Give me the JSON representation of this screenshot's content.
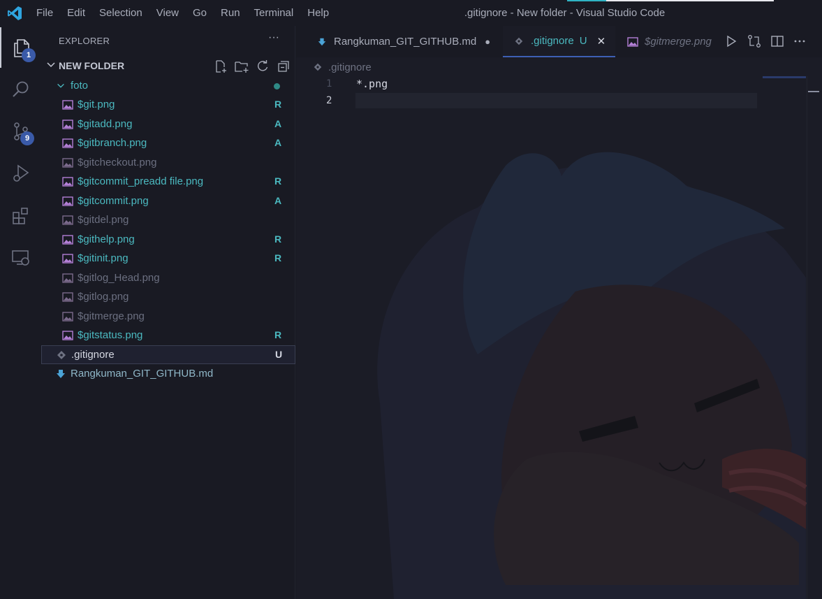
{
  "window_title": ".gitignore - New folder - Visual Studio Code",
  "menu": [
    "File",
    "Edit",
    "Selection",
    "View",
    "Go",
    "Run",
    "Terminal",
    "Help"
  ],
  "activity": {
    "explorer_badge": "1",
    "scm_badge": "9"
  },
  "explorer": {
    "header": "EXPLORER",
    "more": "···",
    "folder_name": "NEW FOLDER",
    "subfolder": "foto",
    "files": [
      {
        "name": "$git.png",
        "status": "R",
        "style": "teal"
      },
      {
        "name": "$gitadd.png",
        "status": "A",
        "style": "teal"
      },
      {
        "name": "$gitbranch.png",
        "status": "A",
        "style": "teal"
      },
      {
        "name": "$gitcheckout.png",
        "status": "",
        "style": "dim"
      },
      {
        "name": "$gitcommit_preadd file.png",
        "status": "R",
        "style": "teal"
      },
      {
        "name": "$gitcommit.png",
        "status": "A",
        "style": "teal"
      },
      {
        "name": "$gitdel.png",
        "status": "",
        "style": "dim"
      },
      {
        "name": "$githelp.png",
        "status": "R",
        "style": "teal"
      },
      {
        "name": "$gitinit.png",
        "status": "R",
        "style": "teal"
      },
      {
        "name": "$gitlog_Head.png",
        "status": "",
        "style": "dim"
      },
      {
        "name": "$gitlog.png",
        "status": "",
        "style": "dim"
      },
      {
        "name": "$gitmerge.png",
        "status": "",
        "style": "dim"
      },
      {
        "name": "$gitstatus.png",
        "status": "R",
        "style": "teal"
      }
    ],
    "root_files": [
      {
        "name": ".gitignore",
        "status": "U"
      },
      {
        "name": "Rangkuman_GIT_GITHUB.md",
        "status": ""
      }
    ]
  },
  "tabs": [
    {
      "label": "Rangkuman_GIT_GITHUB.md",
      "modified": "●"
    },
    {
      "label": ".gitignore",
      "status": "U",
      "close": "✕"
    },
    {
      "label": "$gitmerge.png"
    }
  ],
  "breadcrumb": ".gitignore",
  "editor": {
    "line_numbers": [
      "1",
      "2"
    ],
    "lines": [
      "*.png",
      ""
    ]
  },
  "colors": {
    "accent": "#3d5fb4",
    "teal": "#4bb9c0",
    "badge": "#3a5aa8"
  }
}
